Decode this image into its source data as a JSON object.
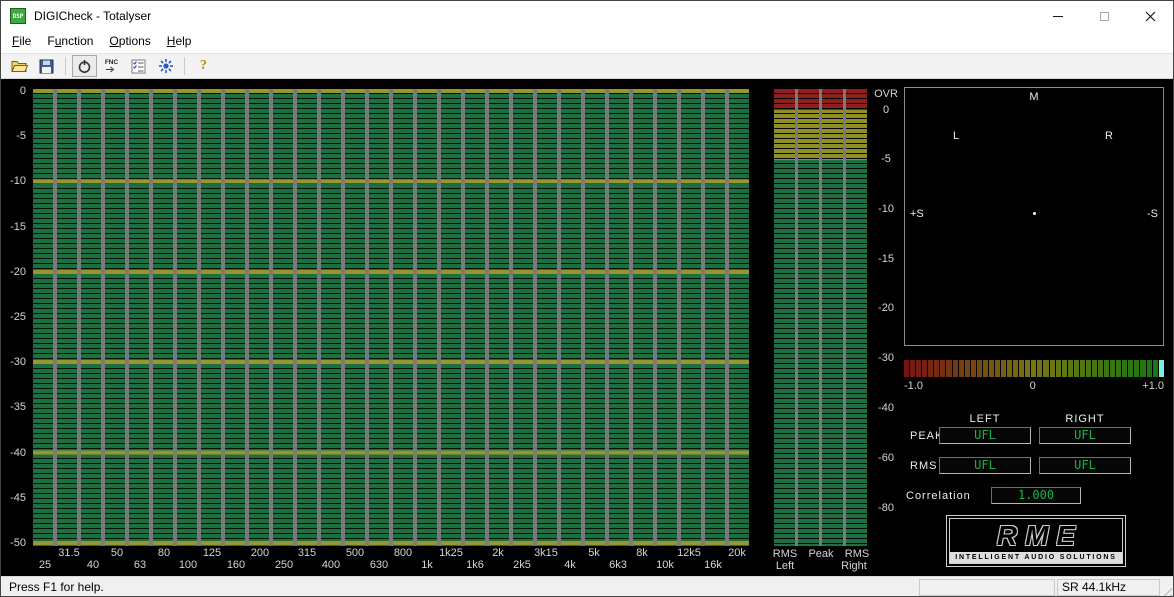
{
  "window": {
    "title": "DIGICheck - Totalyser",
    "icon_label": "DSP"
  },
  "menu": {
    "items": [
      {
        "label": "File",
        "underline": 0
      },
      {
        "label": "Function",
        "underline": 1
      },
      {
        "label": "Options",
        "underline": 0
      },
      {
        "label": "Help",
        "underline": 0
      }
    ]
  },
  "toolbar": {
    "fnc_label": "FNC",
    "help_glyph": "?"
  },
  "spectrum": {
    "db_labels": [
      "0",
      "-5",
      "-10",
      "-15",
      "-20",
      "-25",
      "-30",
      "-35",
      "-40",
      "-45",
      "-50"
    ],
    "bands": [
      "25",
      "31.5",
      "40",
      "50",
      "63",
      "80",
      "100",
      "125",
      "160",
      "200",
      "250",
      "315",
      "400",
      "500",
      "630",
      "800",
      "1k",
      "1k25",
      "1k6",
      "2k",
      "2k5",
      "3k15",
      "4k",
      "5k",
      "6k3",
      "8k",
      "10k",
      "12k5",
      "16k",
      "20k"
    ]
  },
  "meters": {
    "scale": [
      "OVR",
      "0",
      "-5",
      "-10",
      "-15",
      "-20",
      "-30",
      "-40",
      "-60",
      "-80"
    ],
    "captions": {
      "rms_left": "RMS",
      "peak": "Peak",
      "rms_right": "RMS",
      "left": "Left",
      "right": "Right"
    }
  },
  "goniometer": {
    "mid": "M",
    "left": "L",
    "right": "R",
    "plus_s": "+S",
    "minus_s": "-S"
  },
  "correlation": {
    "segments": 43,
    "indicator_color": "#7df2dc",
    "scale": {
      "min": "-1.0",
      "mid": "0",
      "max": "+1.0"
    }
  },
  "readouts": {
    "left_header": "LEFT",
    "right_header": "RIGHT",
    "peak_label": "PEAK",
    "rms_label": "RMS",
    "peak_left": "UFL",
    "peak_right": "UFL",
    "rms_left": "UFL",
    "rms_right": "UFL",
    "correlation_label": "Correlation",
    "correlation_value": "1.000"
  },
  "logo": {
    "brand": "RME",
    "tagline": "INTELLIGENT AUDIO SOLUTIONS"
  },
  "status_bar": {
    "message": "Press F1 for help.",
    "sample_rate": "SR 44.1kHz"
  },
  "colors": {
    "green": "#1d6e41",
    "olive": "#97972f",
    "gapgray": "#7a7a7a",
    "mred": "#8f1f1f",
    "molive": "#8f8f25",
    "valgreen": "#16b24a"
  }
}
